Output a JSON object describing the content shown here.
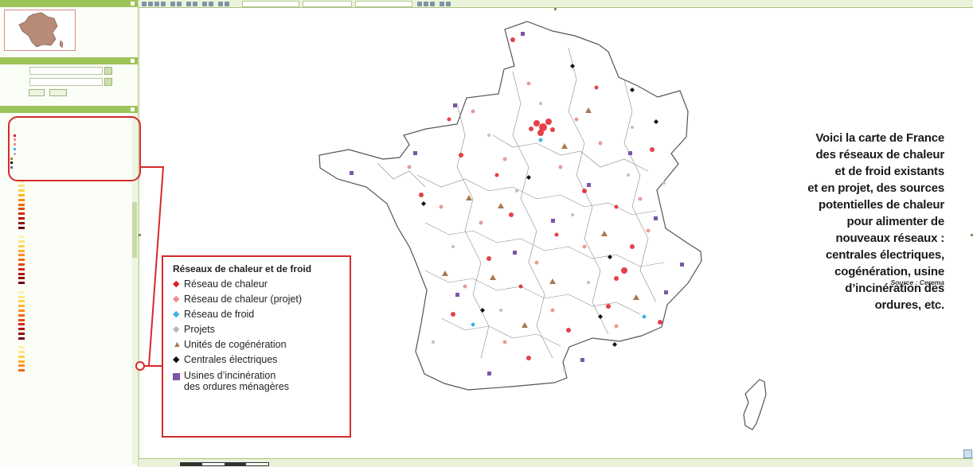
{
  "legend": {
    "title": "Réseaux de chaleur et de froid",
    "items": [
      {
        "label": "Réseau de chaleur",
        "symbol": "◆",
        "color": "#e0202a"
      },
      {
        "label": "Réseau de chaleur (projet)",
        "symbol": "◆",
        "color": "#e89090"
      },
      {
        "label": "Réseau de froid",
        "symbol": "◆",
        "color": "#3cb3e0"
      },
      {
        "label": "Projets",
        "symbol": "◆",
        "color": "#b8b8b8"
      },
      {
        "label": "Unités de cogénération",
        "symbol": "▲",
        "color": "#a87850"
      },
      {
        "label": "Centrales électriques",
        "symbol": "◆",
        "color": "#111111"
      }
    ],
    "last_item": {
      "line1": "Usines d’incinération",
      "line2": "des ordures ménagères",
      "color": "#7a55a8"
    }
  },
  "caption": {
    "lines": [
      "Voici la carte de France",
      "des réseaux de chaleur",
      "et de froid existants",
      "et en projet, des sources",
      "potentielles de chaleur",
      "pour alimenter de",
      "nouveaux réseaux :",
      "centrales électriques,",
      "cogénération, usine",
      "d’incinération des",
      "ordures, etc."
    ],
    "source": "Source : Cerema"
  },
  "colors": {
    "accent": "#d42a2a",
    "panel_header": "#9cc458",
    "heat_network": "#e0202a",
    "heat_project": "#e89090",
    "cogeneration": "#a87850",
    "incineration": "#7a55a8"
  },
  "icons": [
    "search-icon",
    "zoom-in-icon",
    "zoom-out-icon",
    "pan-icon",
    "measure-icon",
    "print-icon"
  ]
}
